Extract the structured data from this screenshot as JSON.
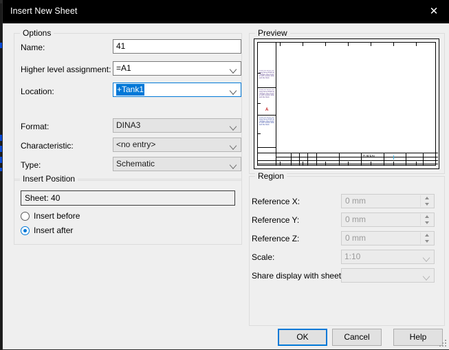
{
  "window": {
    "title": "Insert New Sheet",
    "close_icon": "close-icon",
    "accent_color": "#0078d7",
    "titlebar_bg": "#000000",
    "dialog_bg": "#efefef"
  },
  "options": {
    "group_title": "Options",
    "fields": [
      {
        "label": "Name:",
        "value": "41",
        "kind": "textbox",
        "state": "editable"
      },
      {
        "label": "Higher level assignment:",
        "value": "=A1",
        "kind": "combobox",
        "state": "editable"
      },
      {
        "label": "Location:",
        "value": "+Tank1",
        "kind": "combobox",
        "state": "focused-selected"
      },
      {
        "label": "Format:",
        "value": "DINA3",
        "kind": "combobox",
        "state": "readonly"
      },
      {
        "label": "Characteristic:",
        "value": "<no entry>",
        "kind": "combobox",
        "state": "readonly"
      },
      {
        "label": "Type:",
        "value": "Schematic",
        "kind": "combobox",
        "state": "readonly"
      }
    ]
  },
  "insert_position": {
    "group_title": "Insert Position",
    "sheet_value": "Sheet: 40",
    "radios": [
      {
        "label": "Insert before",
        "selected": false
      },
      {
        "label": "Insert after",
        "selected": true
      }
    ]
  },
  "preview": {
    "group_title": "Preview",
    "titleblock_brand": "ZUKEN",
    "red_mark": "A",
    "placeholder_text": "Zuken E3.series drawing frame DINA3 landscape sheet border with revision table and title block"
  },
  "region": {
    "group_title": "Region",
    "fields": [
      {
        "label": "Reference X:",
        "value": "0 mm",
        "kind": "spinner",
        "state": "disabled"
      },
      {
        "label": "Reference Y:",
        "value": "0 mm",
        "kind": "spinner",
        "state": "disabled"
      },
      {
        "label": "Reference Z:",
        "value": "0 mm",
        "kind": "spinner",
        "state": "disabled"
      },
      {
        "label": "Scale:",
        "value": "1:10",
        "kind": "combobox",
        "state": "disabled"
      },
      {
        "label": "Share display with sheet:",
        "value": "",
        "kind": "combobox",
        "state": "disabled"
      }
    ]
  },
  "buttons": [
    {
      "label": "OK",
      "default": true
    },
    {
      "label": "Cancel",
      "default": false
    },
    {
      "label": "Help",
      "default": false
    }
  ]
}
